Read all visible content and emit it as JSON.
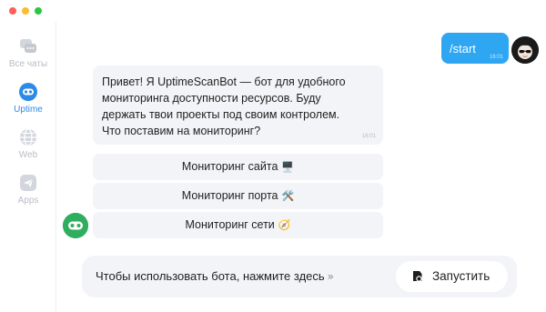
{
  "window": {
    "controls": [
      "close",
      "minimize",
      "maximize"
    ]
  },
  "sidebar": {
    "items": [
      {
        "label": "Все чаты",
        "icon": "chats-icon",
        "active": false
      },
      {
        "label": "Uptime",
        "icon": "bot-face-icon",
        "active": true
      },
      {
        "label": "Web",
        "icon": "globe-icon",
        "active": false
      },
      {
        "label": "Apps",
        "icon": "paper-plane-icon",
        "active": false
      }
    ]
  },
  "chat": {
    "outgoing": {
      "text": "/start",
      "time": "16:01"
    },
    "incoming": {
      "text": "Привет! Я UptimeScanBot — бот для удобного\nмониторинга доступности ресурсов. Буду\nдержать твои проекты под своим контролем.\nЧто поставим на мониторинг?",
      "time": "16:01"
    },
    "keyboard": [
      {
        "label": "Мониторинг сайта",
        "emoji": "🖥️"
      },
      {
        "label": "Мониторинг порта",
        "emoji": "🛠️"
      },
      {
        "label": "Мониторинг сети",
        "emoji": "🧭"
      }
    ]
  },
  "bottom": {
    "hint": "Чтобы использовать бота, нажмите здесь",
    "hint_chevron": "»",
    "start_label": "Запустить"
  },
  "colors": {
    "accent": "#2d8ae6",
    "outgoing_bubble": "#2ea6f2",
    "bot_avatar": "#2fae5f",
    "bubble_bg": "#f3f4f7"
  }
}
